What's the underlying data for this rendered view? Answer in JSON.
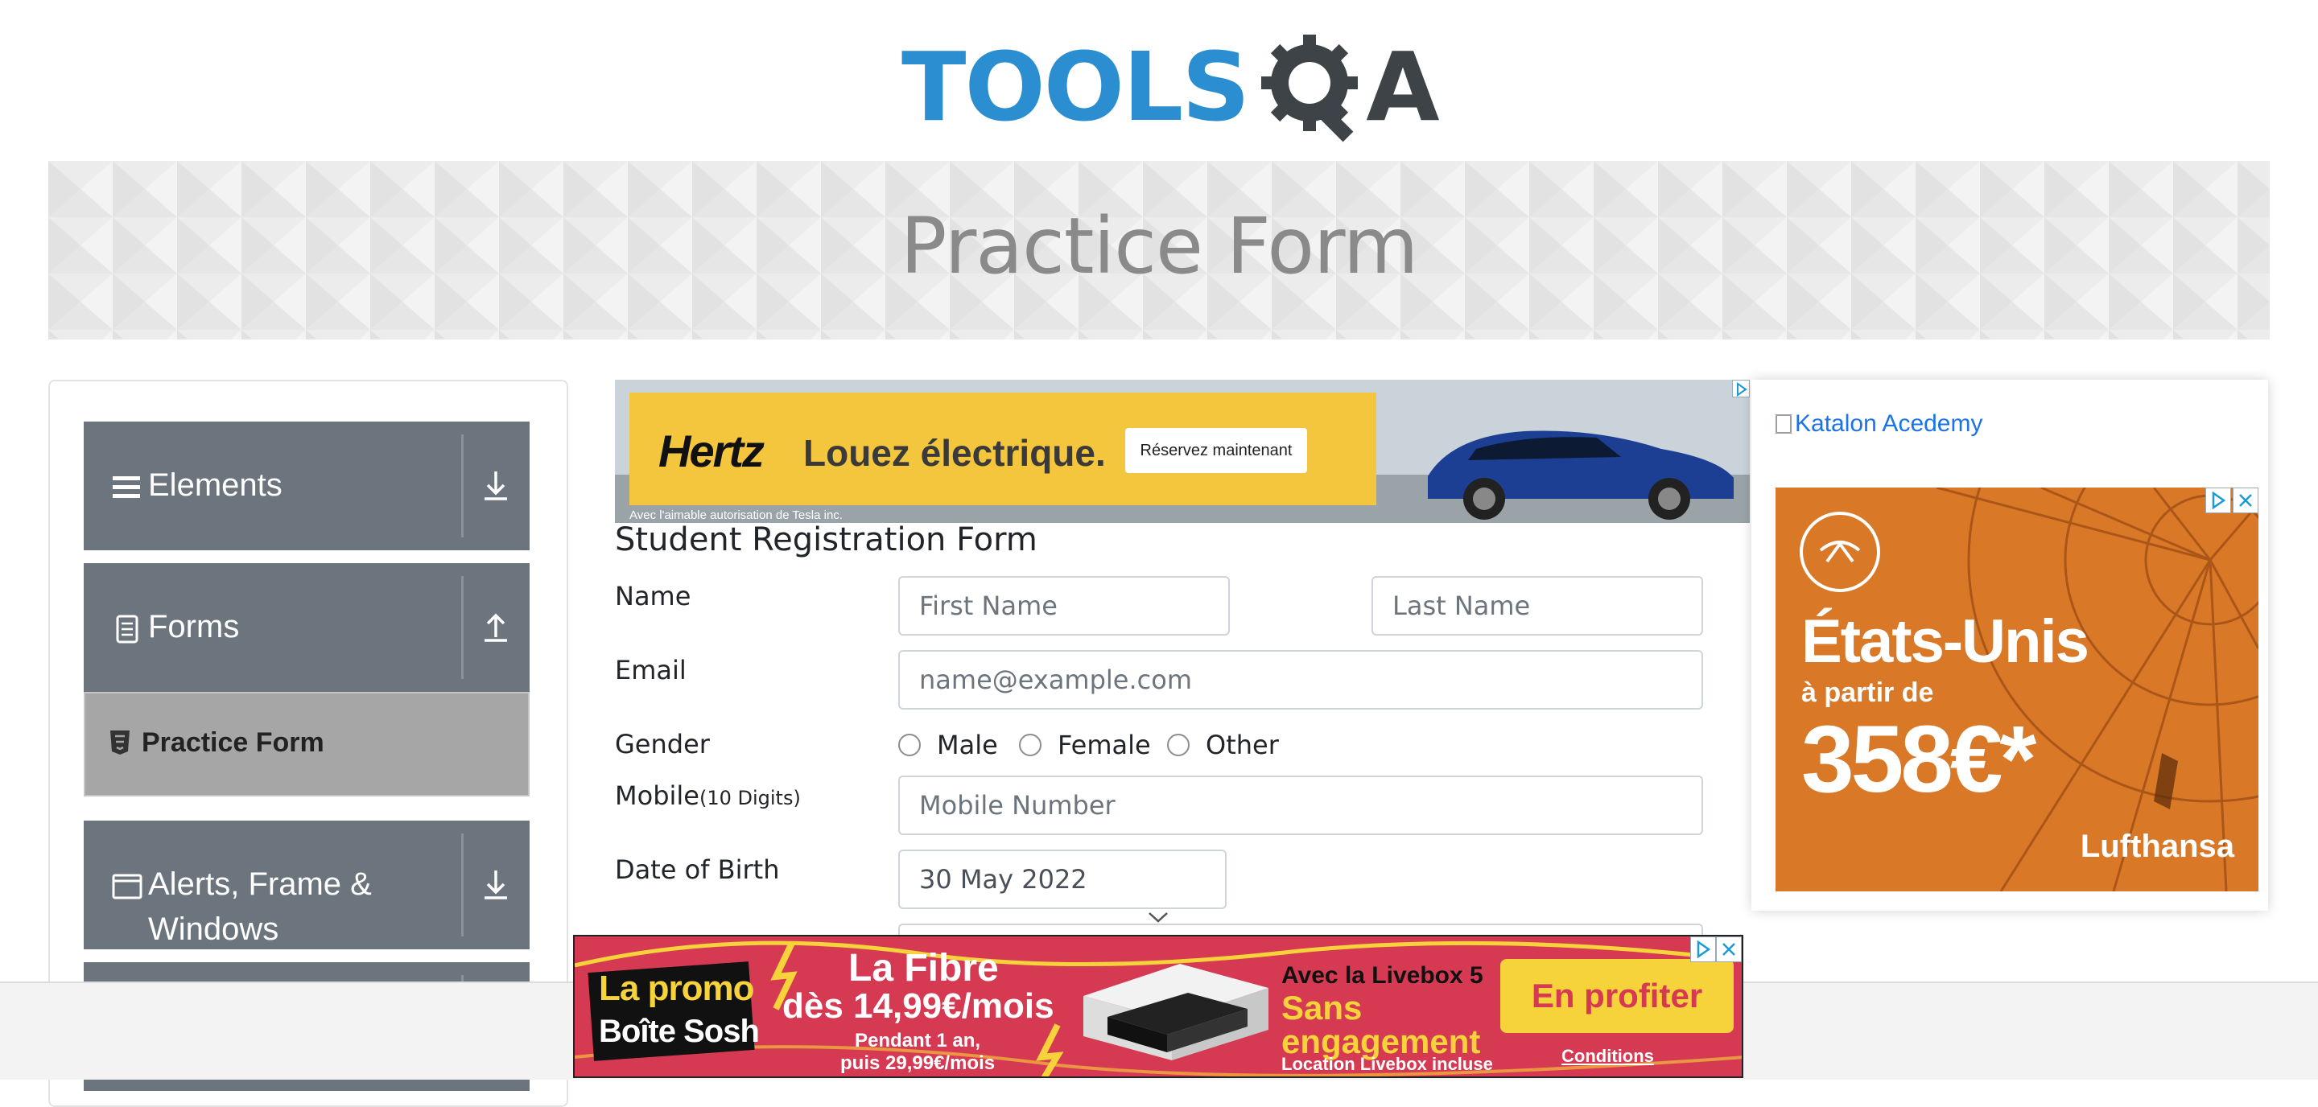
{
  "header": {
    "logo_tools": "TOOLS",
    "logo_a": "A",
    "logo_alt": "TOOLSQA"
  },
  "banner": {
    "title": "Practice Form"
  },
  "sidebar": {
    "groups": [
      {
        "label": "Elements",
        "icon": "hamburger-icon",
        "arrow": "download-icon"
      },
      {
        "label": "Forms",
        "icon": "document-icon",
        "arrow": "upload-icon"
      },
      {
        "label": "Alerts, Frame &",
        "label2": "Windows",
        "icon": "window-icon",
        "arrow": "download-icon"
      }
    ],
    "active_item": {
      "label": "Practice Form",
      "icon": "html5-icon"
    }
  },
  "ad_top": {
    "brand": "Hertz",
    "headline": "Louez électrique.",
    "button": "Réservez maintenant",
    "credit": "Avec l'aimable autorisation de Tesla inc."
  },
  "form": {
    "title": "Student Registration Form",
    "name_label": "Name",
    "first_name_placeholder": "First Name",
    "last_name_placeholder": "Last Name",
    "email_label": "Email",
    "email_placeholder": "name@example.com",
    "gender_label": "Gender",
    "gender_options": [
      "Male",
      "Female",
      "Other"
    ],
    "mobile_label": "Mobile",
    "mobile_hint": "(10 Digits)",
    "mobile_placeholder": "Mobile Number",
    "dob_label": "Date of Birth",
    "dob_value": "30 May 2022"
  },
  "ad_right": {
    "katalon_alt": "Katalon Acedemy",
    "lufthansa_title": "États-Unis",
    "lufthansa_sub": "à partir de",
    "lufthansa_price": "358€*",
    "lufthansa_brand": "Lufthansa"
  },
  "ad_bottom": {
    "promo_1": "La promo",
    "promo_2": "Boîte Sosh",
    "fibre_1": "La Fibre",
    "fibre_2": "dès 14,99€/mois",
    "fibre_3a": "Pendant 1 an,",
    "fibre_3b": "puis 29,99€/mois",
    "livebox_1": "Avec la Livebox 5",
    "livebox_2a": "Sans",
    "livebox_2b": "engagement",
    "livebox_3": "Location Livebox incluse",
    "cta": "En profiter",
    "conditions": "Conditions"
  },
  "colors": {
    "logo_blue": "#2a8ed0",
    "logo_dark": "#3e4348",
    "nav_gray": "#6c757d",
    "active_gray": "#a6a6a6",
    "hertz_yellow": "#f4c63d",
    "lufthansa_orange": "#d97826",
    "sosh_red": "#d63a52"
  }
}
